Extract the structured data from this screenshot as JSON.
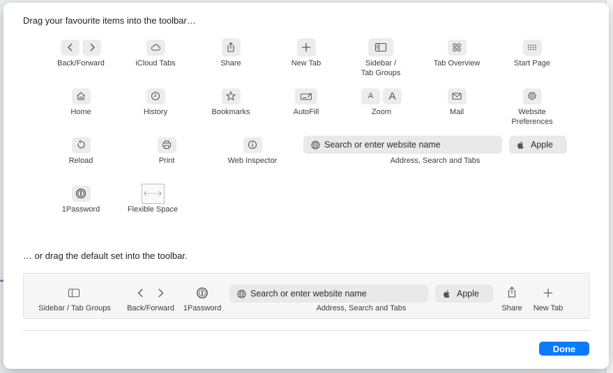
{
  "headings": {
    "top": "Drag your favourite items into the toolbar…",
    "bottom": "… or drag the default set into the toolbar."
  },
  "items": {
    "back_forward": "Back/Forward",
    "icloud_tabs": "iCloud Tabs",
    "share": "Share",
    "new_tab": "New Tab",
    "sidebar_line1": "Sidebar /",
    "sidebar_line2": "Tab Groups",
    "tab_overview": "Tab Overview",
    "start_page": "Start Page",
    "home": "Home",
    "history": "History",
    "bookmarks": "Bookmarks",
    "autofill": "AutoFill",
    "zoom": "Zoom",
    "mail": "Mail",
    "website_prefs_line1": "Website",
    "website_prefs_line2": "Preferences",
    "reload": "Reload",
    "print": "Print",
    "web_inspector": "Web Inspector",
    "address_placeholder": "Search or enter website name",
    "address_label": "Address, Search and Tabs",
    "apple": "Apple",
    "onepassword": "1Password",
    "flexible_space": "Flexible Space",
    "zoom_glyph": "A"
  },
  "default_set": {
    "sidebar": "Sidebar / Tab Groups",
    "back_forward": "Back/Forward",
    "onepassword": "1Password",
    "address_placeholder": "Search or enter website name",
    "address_label": "Address, Search and Tabs",
    "apple": "Apple",
    "share": "Share",
    "new_tab": "New Tab"
  },
  "buttons": {
    "done": "Done"
  },
  "colors": {
    "accent": "#0a7aff",
    "icon_bg": "#ececec"
  }
}
